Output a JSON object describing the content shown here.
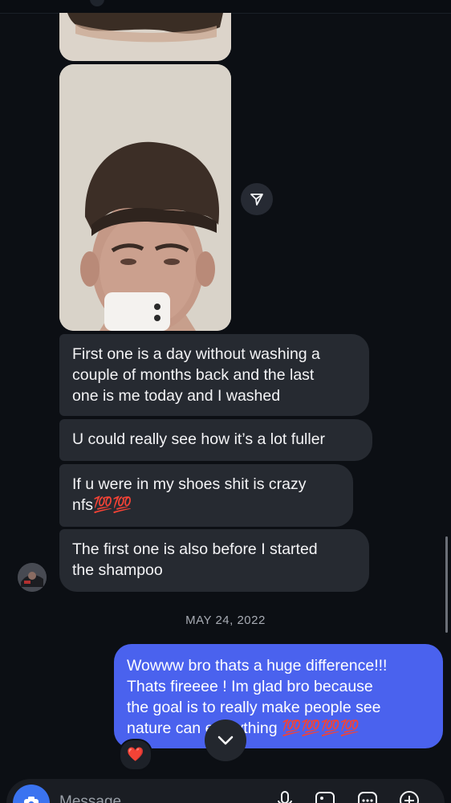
{
  "messages": {
    "received": [
      "First one is a day without washing a\ncouple of months back and the last\none is me today and I washed",
      "U could really see how it’s a lot fuller",
      "If u were in my shoes shit is crazy\nnfs💯💯",
      "The first one is also before I started\nthe shampoo"
    ],
    "date_separator": "MAY 24, 2022",
    "sent": "Wowww bro thats a huge difference!!!\nThats fireeee ! Im glad bro because\nthe goal is to really make people see\nnature can      everything 💯💯💯💯",
    "reaction": "❤️"
  },
  "composer": {
    "placeholder": "Message"
  },
  "icons": {
    "forward": "send-forward-icon",
    "scroll_down": "chevron-down-icon",
    "camera": "camera-icon",
    "microphone": "microphone-icon",
    "gallery": "gallery-icon",
    "sticker": "sticker-icon",
    "add": "plus-circle-icon"
  },
  "colors": {
    "background": "#0c0f14",
    "received_bubble": "#262a31",
    "sent_bubble": "#4a62ee",
    "camera_button": "#3a73f0"
  }
}
